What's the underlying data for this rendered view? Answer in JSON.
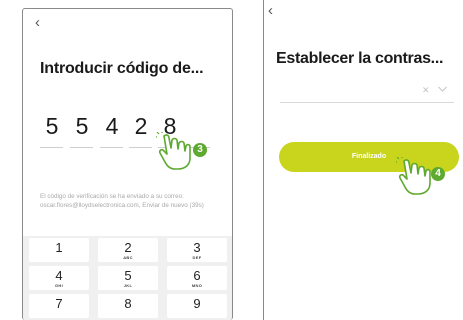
{
  "colors": {
    "accent": "#c9d51c",
    "badge": "#5ea92f"
  },
  "screen1": {
    "back_icon": "chevron-left-icon",
    "title": "Introducir código de...",
    "code_digits": [
      "5",
      "5",
      "4",
      "2",
      "8"
    ],
    "info_text": "El código de verificación se ha enviado a su correo: oscar.flores@lloydselectronica.com, Enviar de nuevo (39s)",
    "step_badge": "3",
    "keypad": [
      {
        "num": "1",
        "letters": ""
      },
      {
        "num": "2",
        "letters": "ABC"
      },
      {
        "num": "3",
        "letters": "DEF"
      },
      {
        "num": "4",
        "letters": "GHI"
      },
      {
        "num": "5",
        "letters": "JKL"
      },
      {
        "num": "6",
        "letters": "MNO"
      },
      {
        "num": "7",
        "letters": ""
      },
      {
        "num": "8",
        "letters": ""
      },
      {
        "num": "9",
        "letters": ""
      }
    ]
  },
  "screen2": {
    "back_icon": "chevron-left-icon",
    "title": "Establecer la contras...",
    "password_value": "",
    "clear_icon": "close-icon",
    "toggle_icon": "eye-icon",
    "finish_label": "Finalizado",
    "step_badge": "4"
  }
}
